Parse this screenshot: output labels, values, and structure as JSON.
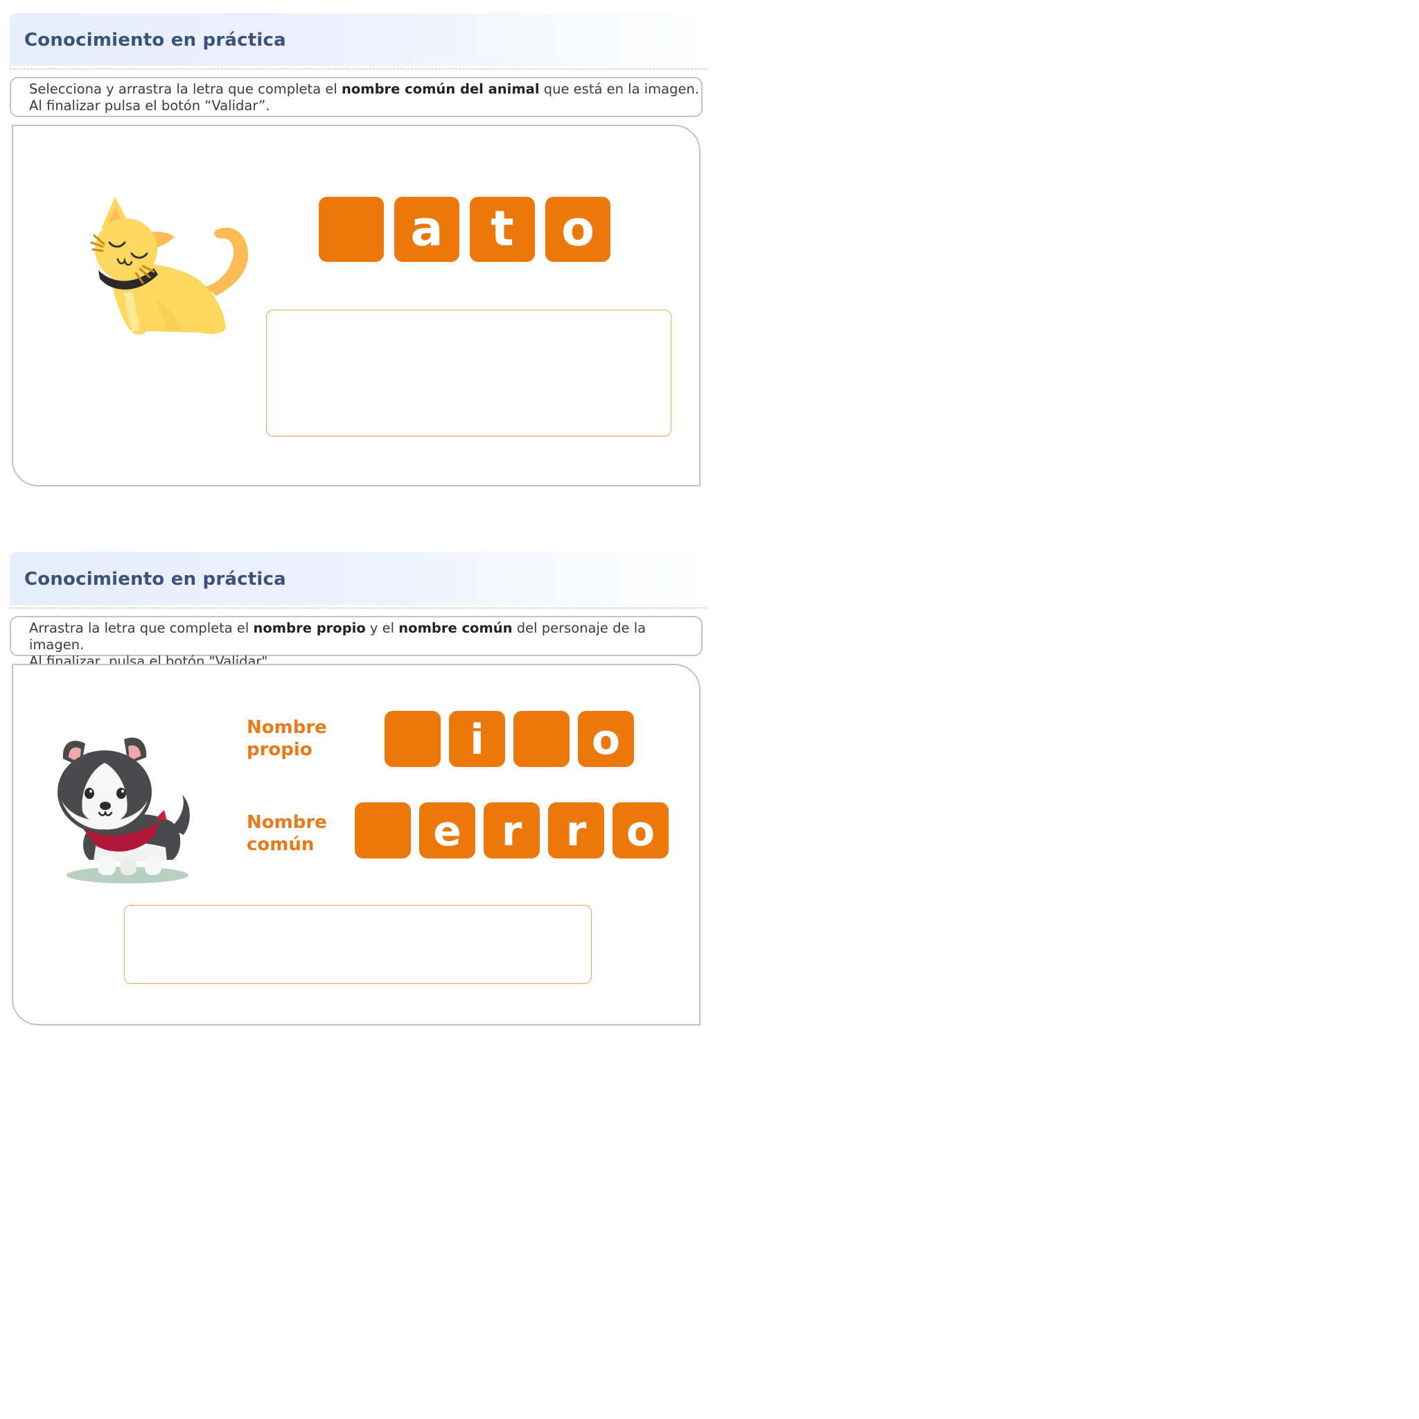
{
  "exercise1": {
    "title": "Conocimiento en práctica",
    "instruction": {
      "line1_pre": "Selecciona y arrastra la letra que completa el ",
      "line1_bold": "nombre común del animal",
      "line1_post": " que está en la imagen.",
      "line2": "Al finalizar pulsa el botón “Validar”."
    },
    "image_icon": "cat-icon",
    "letters": [
      "",
      "a",
      "t",
      "o"
    ]
  },
  "exercise2": {
    "title": "Conocimiento en práctica",
    "instruction": {
      "line1_pre": "Arrastra la letra que completa el ",
      "line1_bold1": "nombre propio",
      "line1_mid": " y el ",
      "line1_bold2": "nombre común",
      "line1_post": " del personaje de la imagen.",
      "line2": "Al finalizar, pulsa el botón \"Validar\"."
    },
    "image_icon": "husky-dog-icon",
    "proper_name": {
      "label_line1": "Nombre",
      "label_line2": "propio",
      "letters": [
        "",
        "i",
        "",
        "o"
      ]
    },
    "common_name": {
      "label_line1": "Nombre",
      "label_line2": "común",
      "letters": [
        "",
        "e",
        "r",
        "r",
        "o"
      ]
    }
  },
  "colors": {
    "tile": "#ec780c",
    "title": "#3b5378",
    "label": "#ea7a17",
    "dropzone_border": "#f2a35f"
  }
}
